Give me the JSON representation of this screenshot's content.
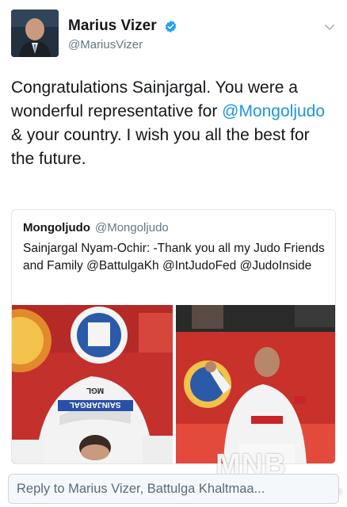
{
  "author": {
    "display_name": "Marius Vizer",
    "handle": "@MariusVizer"
  },
  "tweet": {
    "text_part1": "Congratulations Sainjargal. You were a wonderful representative for ",
    "mention": "@Mongoljudo",
    "text_part2": " & your country. I wish you all the best for the future."
  },
  "quoted_tweet": {
    "name": "Mongoljudo",
    "handle": "@Mongoljudo",
    "text": "Sainjargal Nyam-Ochir: -Thank you all my Judo Friends and Family @BattulgaKh @IntJudoFed @JudoInside",
    "left_photo_back_text": "SAINJARGAL",
    "left_photo_country": "MGL"
  },
  "reply": {
    "placeholder": "Reply to Marius Vizer, Battulga Khaltmaa..."
  },
  "watermark": {
    "logo": "MNB",
    "sub": ".mn"
  },
  "colors": {
    "link": "#1b95e0",
    "verified": "#1da1f2",
    "secondary_text": "#657786"
  },
  "icons": [
    "verified-badge-icon",
    "chevron-down-icon"
  ]
}
